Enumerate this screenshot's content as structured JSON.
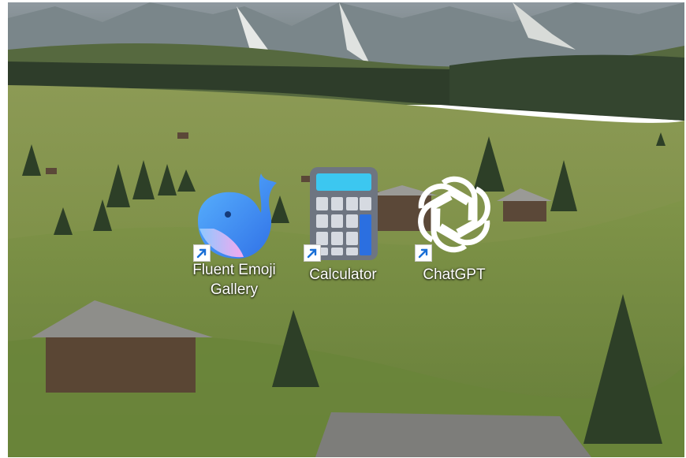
{
  "desktop": {
    "wallpaper": "alpine-meadow-with-wooden-huts",
    "icons": [
      {
        "label_line1": "Fluent Emoji",
        "label_line2": "Gallery",
        "icon": "whale-icon",
        "shortcut": true
      },
      {
        "label_line1": "Calculator",
        "label_line2": "",
        "icon": "calculator-icon",
        "shortcut": true
      },
      {
        "label_line1": "ChatGPT",
        "label_line2": "",
        "icon": "openai-logo-icon",
        "shortcut": true
      }
    ]
  },
  "colors": {
    "whale_blue": "#4a9cf0",
    "whale_pink": "#f4a8ee",
    "calculator_body": "#6e7581",
    "calculator_display": "#3cc7f0",
    "calculator_accent": "#2b6fe0",
    "chatgpt_logo": "#ffffff",
    "shortcut_arrow": "#1a6fd6"
  }
}
